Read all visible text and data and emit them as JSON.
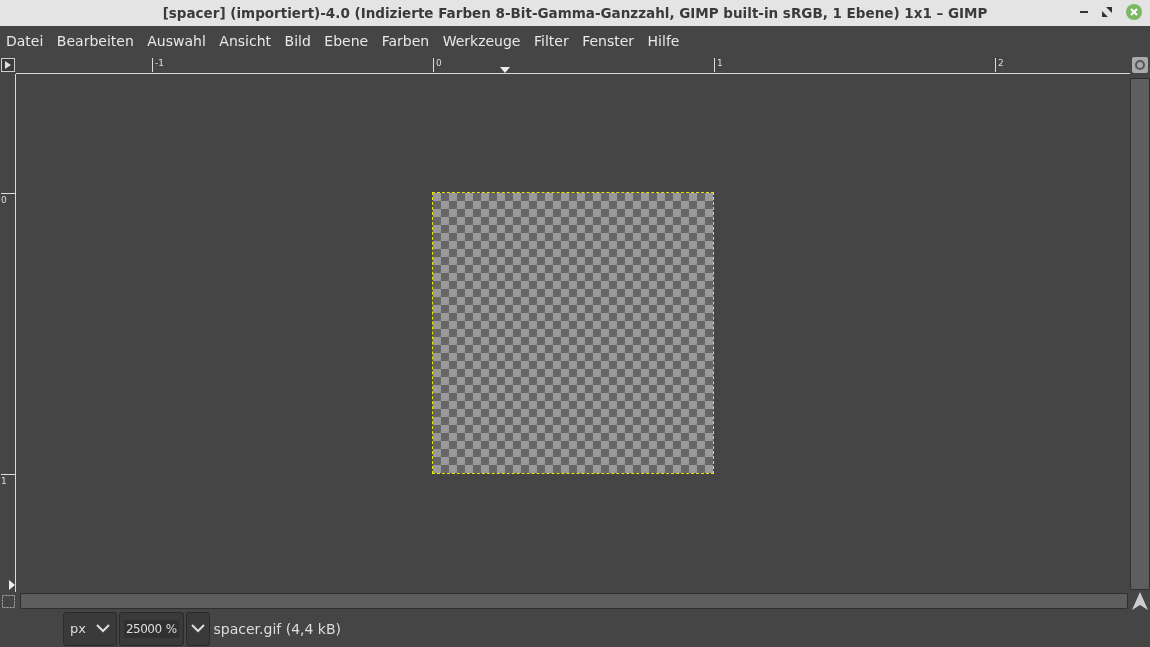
{
  "window": {
    "title": "[spacer] (importiert)-4.0 (Indizierte Farben 8-Bit-Gamma-Ganzzahl, GIMP built-in sRGB, 1 Ebene) 1x1 – GIMP"
  },
  "menu": [
    "Datei",
    "Bearbeiten",
    "Auswahl",
    "Ansicht",
    "Bild",
    "Ebene",
    "Farben",
    "Werkzeuge",
    "Filter",
    "Fenster",
    "Hilfe"
  ],
  "ruler_horizontal": [
    "-1",
    "0",
    "1",
    "2"
  ],
  "ruler_vertical": [
    "0",
    "1"
  ],
  "status_bar": {
    "unit": "px",
    "zoom": "25000",
    "zoom_suffix": "%",
    "file_info": "spacer.gif (4,4 kB)"
  }
}
